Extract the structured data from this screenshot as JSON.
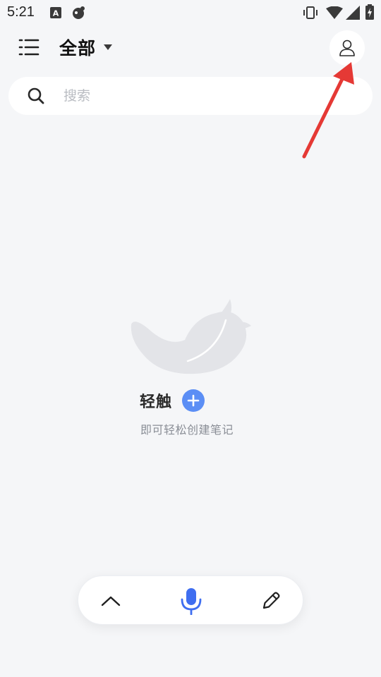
{
  "status_bar": {
    "time": "5:21",
    "left_icons": [
      "keyboard-a-icon",
      "app-notification-icon"
    ],
    "right_icons": [
      "vibrate-icon",
      "wifi-icon",
      "signal-icon",
      "battery-charging-icon"
    ]
  },
  "header": {
    "menu_icon": "menu-icon",
    "folder_title": "全部",
    "folder_dropdown_icon": "caret-down-icon",
    "avatar_icon": "user-icon"
  },
  "search": {
    "icon": "search-icon",
    "placeholder": "搜索",
    "value": ""
  },
  "annotation": {
    "color": "#e53935",
    "icon": "red-arrow-icon"
  },
  "empty_state": {
    "illustration": "feather-icon",
    "title": "轻触",
    "add_icon": "plus-icon",
    "subtitle": "即可轻松创建笔记",
    "accent": "#5b8ef5"
  },
  "bottom_bar": {
    "expand_icon": "chevron-up-icon",
    "voice_icon": "microphone-icon",
    "voice_color": "#3f6ef0",
    "edit_icon": "pencil-icon"
  }
}
